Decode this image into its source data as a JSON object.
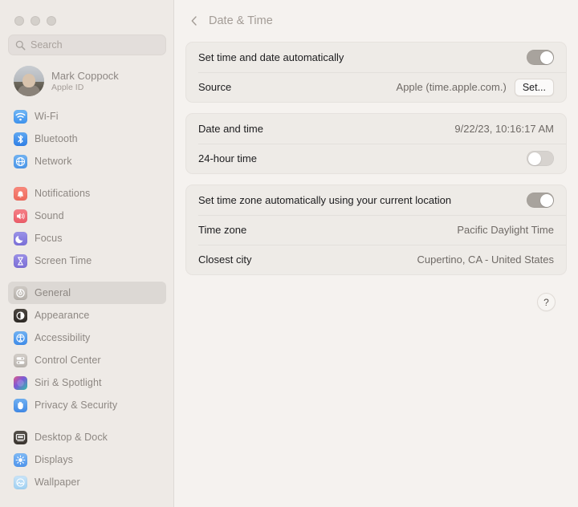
{
  "window": {
    "traffic_lights": [
      "close",
      "minimize",
      "zoom"
    ]
  },
  "sidebar": {
    "search": {
      "placeholder": "Search",
      "value": "",
      "icon": "search-icon"
    },
    "account": {
      "name": "Mark Coppock",
      "subtitle": "Apple ID",
      "avatar": "user-avatar"
    },
    "groups": [
      {
        "items": [
          {
            "label": "Wi-Fi",
            "icon": "wifi-icon",
            "selected": false
          },
          {
            "label": "Bluetooth",
            "icon": "bluetooth-icon",
            "selected": false
          },
          {
            "label": "Network",
            "icon": "network-globe-icon",
            "selected": false
          }
        ]
      },
      {
        "items": [
          {
            "label": "Notifications",
            "icon": "bell-icon",
            "selected": false
          },
          {
            "label": "Sound",
            "icon": "speaker-icon",
            "selected": false
          },
          {
            "label": "Focus",
            "icon": "moon-icon",
            "selected": false
          },
          {
            "label": "Screen Time",
            "icon": "hourglass-icon",
            "selected": false
          }
        ]
      },
      {
        "items": [
          {
            "label": "General",
            "icon": "gear-icon",
            "selected": true
          },
          {
            "label": "Appearance",
            "icon": "appearance-icon",
            "selected": false
          },
          {
            "label": "Accessibility",
            "icon": "accessibility-icon",
            "selected": false
          },
          {
            "label": "Control Center",
            "icon": "control-center-icon",
            "selected": false
          },
          {
            "label": "Siri & Spotlight",
            "icon": "siri-icon",
            "selected": false
          },
          {
            "label": "Privacy & Security",
            "icon": "hand-privacy-icon",
            "selected": false
          }
        ]
      },
      {
        "items": [
          {
            "label": "Desktop & Dock",
            "icon": "desktop-dock-icon",
            "selected": false
          },
          {
            "label": "Displays",
            "icon": "display-brightness-icon",
            "selected": false
          },
          {
            "label": "Wallpaper",
            "icon": "wallpaper-icon",
            "selected": false
          }
        ]
      }
    ]
  },
  "content": {
    "back_icon": "chevron-left-icon",
    "title": "Date & Time",
    "cards": [
      {
        "rows": [
          {
            "label": "Set time and date automatically",
            "control": "toggle",
            "toggle_on": true
          },
          {
            "label": "Source",
            "value": "Apple (time.apple.com.)",
            "control": "button",
            "button_label": "Set..."
          }
        ]
      },
      {
        "rows": [
          {
            "label": "Date and time",
            "value": "9/22/23, 10:16:17 AM",
            "control": "none"
          },
          {
            "label": "24-hour time",
            "control": "toggle",
            "toggle_on": false
          }
        ]
      },
      {
        "rows": [
          {
            "label": "Set time zone automatically using your current location",
            "control": "toggle",
            "toggle_on": true
          },
          {
            "label": "Time zone",
            "value": "Pacific Daylight Time",
            "control": "none"
          },
          {
            "label": "Closest city",
            "value": "Cupertino, CA - United States",
            "control": "none"
          }
        ]
      }
    ],
    "help_button": {
      "label": "?",
      "icon": "question-mark-icon"
    }
  },
  "colors": {
    "sidebar_bg": "#eeeae6",
    "content_bg": "#f5f2ef",
    "card_bg": "#eeebe7",
    "selected_row": "#dcd8d4",
    "label_text": "#1c1c1e",
    "value_text": "#6f6a66",
    "sidebar_text": "#8d8782"
  }
}
